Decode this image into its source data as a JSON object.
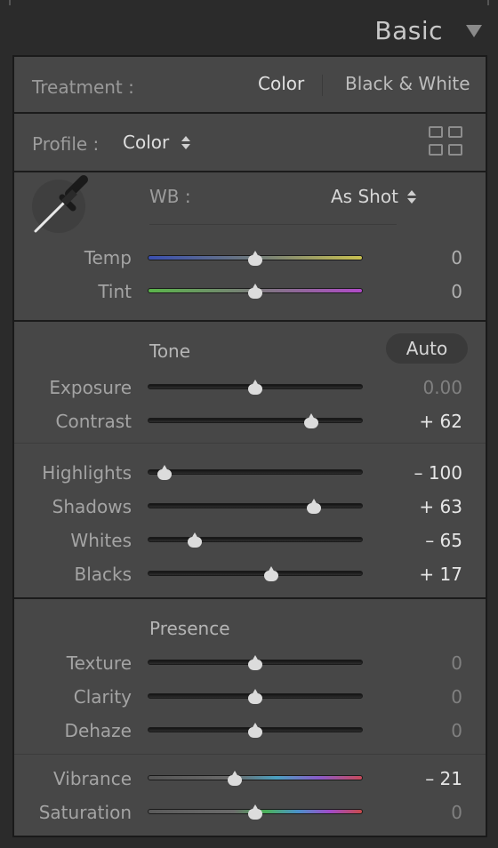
{
  "panel": {
    "title": "Basic"
  },
  "treatment": {
    "label": "Treatment :",
    "options": [
      "Color",
      "Black & White"
    ]
  },
  "profile": {
    "label": "Profile :",
    "value": "Color"
  },
  "wb": {
    "label": "WB :",
    "value": "As Shot"
  },
  "sliders": {
    "temp": {
      "label": "Temp",
      "value": "0",
      "position": 0.5
    },
    "tint": {
      "label": "Tint",
      "value": "0",
      "position": 0.5
    },
    "exposure": {
      "label": "Exposure",
      "value": "0.00",
      "position": 0.5
    },
    "contrast": {
      "label": "Contrast",
      "value": "+ 62",
      "position": 0.78
    },
    "highlights": {
      "label": "Highlights",
      "value": "– 100",
      "position": 0.05
    },
    "shadows": {
      "label": "Shadows",
      "value": "+ 63",
      "position": 0.79
    },
    "whites": {
      "label": "Whites",
      "value": "– 65",
      "position": 0.2
    },
    "blacks": {
      "label": "Blacks",
      "value": "+ 17",
      "position": 0.58
    },
    "texture": {
      "label": "Texture",
      "value": "0",
      "position": 0.5
    },
    "clarity": {
      "label": "Clarity",
      "value": "0",
      "position": 0.5
    },
    "dehaze": {
      "label": "Dehaze",
      "value": "0",
      "position": 0.5
    },
    "vibrance": {
      "label": "Vibrance",
      "value": "– 21",
      "position": 0.4
    },
    "saturation": {
      "label": "Saturation",
      "value": "0",
      "position": 0.5
    }
  },
  "tone": {
    "label": "Tone",
    "auto_label": "Auto"
  },
  "presence": {
    "label": "Presence"
  },
  "icons": {
    "collapse": "triangle-down-icon",
    "profile_browser": "grid-icon",
    "wb_picker": "eyedropper-icon",
    "stepper": "up-down-arrows-icon"
  }
}
